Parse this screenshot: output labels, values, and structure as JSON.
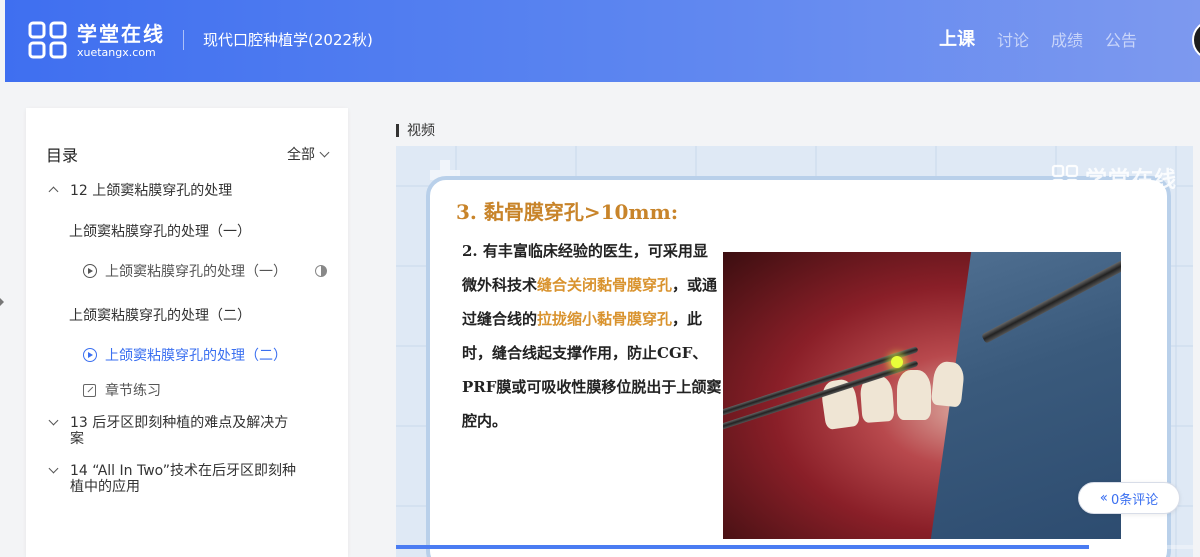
{
  "header": {
    "logo_cn": "学堂在线",
    "logo_en": "xuetangx.com",
    "course_title": "现代口腔种植学(2022秋)",
    "nav": [
      "上课",
      "讨论",
      "成绩",
      "公告"
    ],
    "active_nav": "上课"
  },
  "sidebar": {
    "title": "目录",
    "filter_label": "全部",
    "chapters": [
      {
        "label": "12 上颌窦粘膜穿孔的处理",
        "expanded": true,
        "sections": [
          {
            "label": "上颌窦粘膜穿孔的处理（一）",
            "items": [
              {
                "label": "上颌窦粘膜穿孔的处理（一）",
                "type": "video",
                "progress": 0.5
              }
            ]
          },
          {
            "label": "上颌窦粘膜穿孔的处理（二）",
            "items": [
              {
                "label": "上颌窦粘膜穿孔的处理（二）",
                "type": "video",
                "current": true
              },
              {
                "label": "章节练习",
                "type": "exercise"
              }
            ]
          }
        ]
      },
      {
        "label": "13 后牙区即刻种植的难点及解决方案",
        "expanded": false
      },
      {
        "label": "14 “All In Two”技术在后牙区即刻种植中的应用",
        "expanded": false
      }
    ]
  },
  "main": {
    "section_label": "视频",
    "video": {
      "watermark": "学堂在线",
      "slide_title": "3. 黏骨膜穿孔>10mm:",
      "slide_parts": [
        {
          "text": "2. 有丰富临床经验的医生，可采用显微外科技术",
          "hl": false
        },
        {
          "text": "缝合关闭黏骨膜穿孔",
          "hl": true
        },
        {
          "text": "，或通过缝合线的",
          "hl": false
        },
        {
          "text": "拉拢缩小黏骨膜穿孔",
          "hl": true
        },
        {
          "text": "，此时，缝合线起支撑作用，防止CGF、PRF膜或可吸收性膜移位脱出于上颌窦腔内。",
          "hl": false
        }
      ],
      "progress": 0.87
    },
    "comment_button": "0条评论"
  },
  "colors": {
    "accent": "#3a6ff0",
    "highlight": "#d9932e"
  }
}
